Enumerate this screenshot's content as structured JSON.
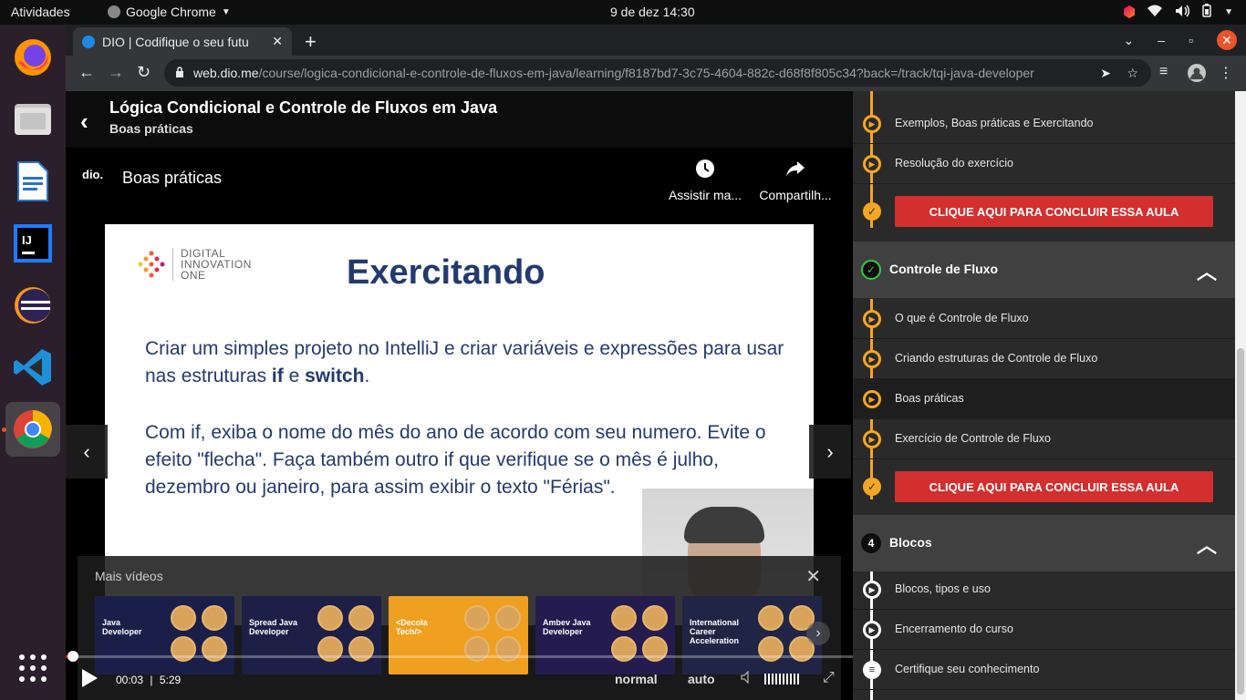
{
  "os": {
    "activities": "Atividades",
    "app_name": "Google Chrome",
    "clock": "9 de dez  14:30"
  },
  "browser": {
    "tab_title": "DIO | Codifique o seu futu",
    "url_host": "web.dio.me",
    "url_path": "/course/logica-condicional-e-controle-de-fluxos-em-java/learning/f8187bd7-3c75-4604-882c-d68f8f805c34?back=/track/tqi-java-developer"
  },
  "course": {
    "title": "Lógica Condicional e Controle de Fluxos em Java",
    "current_lesson": "Boas práticas"
  },
  "player": {
    "channel_logo": "dio.",
    "video_title": "Boas práticas",
    "watch_later_label": "Assistir ma...",
    "share_label": "Compartilh...",
    "more_videos_label": "Mais vídeos",
    "current_time": "00:03",
    "separator": "|",
    "duration": "5:29",
    "speed": "normal",
    "quality": "auto",
    "progress_fraction": 0.009
  },
  "slide": {
    "brand_line1": "DIGITAL",
    "brand_line2": "INNOVATION",
    "brand_line3": "ONE",
    "heading": "Exercitando",
    "para1_a": "Criar um simples projeto no IntelliJ e criar variáveis e expressões para usar nas estruturas ",
    "para1_if": "if",
    "para1_e": " e ",
    "para1_switch": "switch",
    "para1_end": ".",
    "para2": "Com if, exiba o nome do mês do ano de acordo com seu numero. Evite o efeito \"flecha\". Faça também outro if que verifique se o mês é julho, dezembro ou janeiro, para assim exibir o texto \"Férias\"."
  },
  "thumbnails": [
    {
      "text": "Java Developer",
      "bg": "#1a1f4a"
    },
    {
      "text": "Spread Java Developer",
      "bg": "#1d1f47"
    },
    {
      "text": "<Decola Tech/>",
      "bg": "#f0a020"
    },
    {
      "text": "Ambev Java Developer",
      "bg": "#241c4e"
    },
    {
      "text": "International Career Acceleration",
      "bg": "#202545"
    }
  ],
  "sidebar": {
    "top_items": [
      {
        "label": "Exemplos, Boas práticas e Exercitando"
      },
      {
        "label": "Resolução do exercício"
      }
    ],
    "conclude_label": "CLIQUE AQUI PARA CONCLUIR ESSA AULA",
    "module_controle": {
      "title": "Controle de Fluxo",
      "items": [
        {
          "label": "O que é Controle de Fluxo"
        },
        {
          "label": "Criando estruturas de Controle de Fluxo"
        },
        {
          "label": "Boas práticas"
        },
        {
          "label": "Exercício de Controle de Fluxo"
        }
      ]
    },
    "module_blocos": {
      "number": "4",
      "title": "Blocos",
      "items": [
        {
          "label": "Blocos, tipos e uso"
        },
        {
          "label": "Encerramento do curso"
        },
        {
          "label": "Certifique seu conhecimento"
        }
      ]
    }
  },
  "colors": {
    "accent_orange": "#f5a623",
    "conclude_red": "#d32f2f",
    "progress_red": "#ff0000",
    "slide_text": "#233a6e"
  }
}
